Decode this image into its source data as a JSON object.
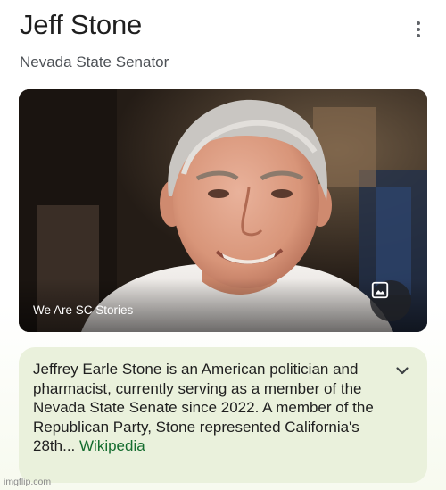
{
  "header": {
    "title": "Jeff Stone",
    "subtitle": "Nevada State Senator",
    "more_icon": "more-vert-icon"
  },
  "image": {
    "source": "We Are SC Stories",
    "view_icon": "image-icon"
  },
  "description": {
    "text": "Jeffrey Earle Stone is an American politician and pharmacist, currently serving as a member of the Nevada State Senate since 2022. A member of the Republican Party, Stone represented California's 28th",
    "ellipsis": "...",
    "link": "Wikipedia",
    "expand_icon": "chevron-down-icon"
  },
  "watermark": "imgflip.com",
  "colors": {
    "card_bg": "#eaf1dc",
    "link": "#146c2e",
    "title": "#1f1f1f",
    "subtitle": "#4d5156"
  }
}
